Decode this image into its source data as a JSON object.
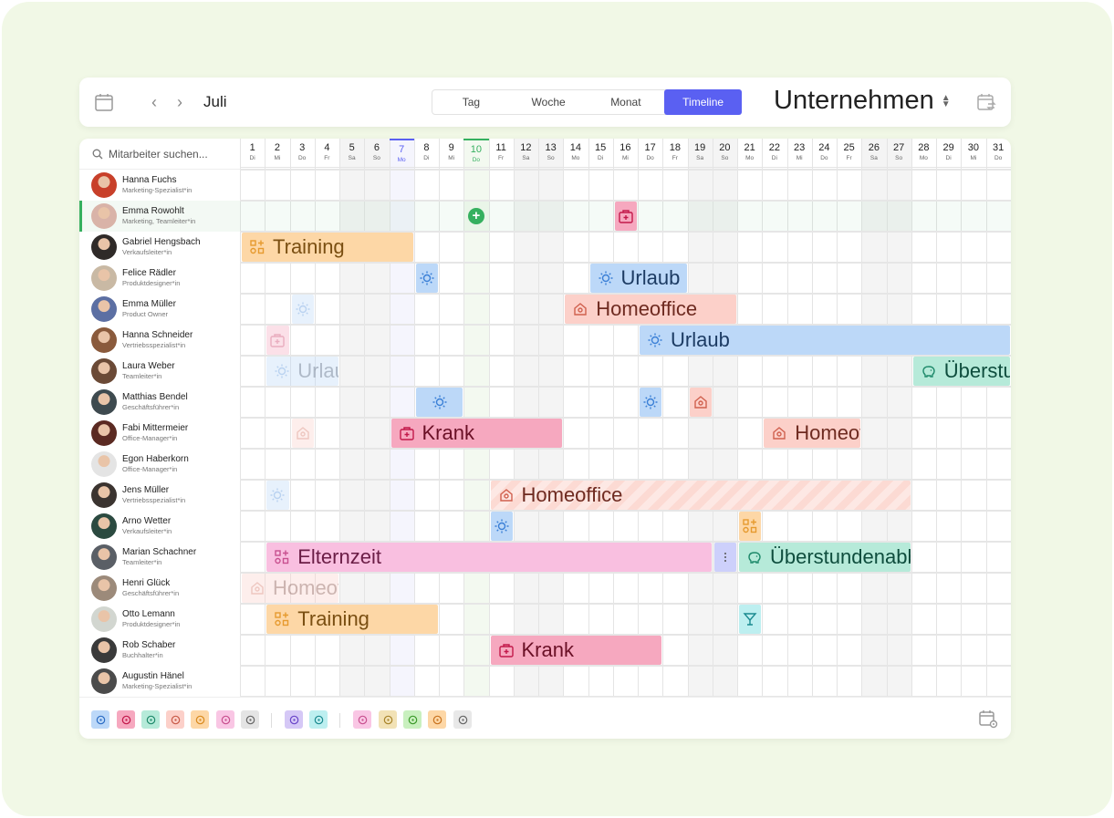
{
  "header": {
    "month": "Juli",
    "tabs": [
      "Tag",
      "Woche",
      "Monat",
      "Timeline"
    ],
    "active_tab": "Timeline",
    "company": "Unternehmen"
  },
  "search": {
    "placeholder": "Mitarbeiter suchen..."
  },
  "days": [
    {
      "d": "1",
      "w": "Di"
    },
    {
      "d": "2",
      "w": "Mi"
    },
    {
      "d": "3",
      "w": "Do"
    },
    {
      "d": "4",
      "w": "Fr"
    },
    {
      "d": "5",
      "w": "Sa"
    },
    {
      "d": "6",
      "w": "So"
    },
    {
      "d": "7",
      "w": "Mo"
    },
    {
      "d": "8",
      "w": "Di"
    },
    {
      "d": "9",
      "w": "Mi"
    },
    {
      "d": "10",
      "w": "Do"
    },
    {
      "d": "11",
      "w": "Fr"
    },
    {
      "d": "12",
      "w": "Sa"
    },
    {
      "d": "13",
      "w": "So"
    },
    {
      "d": "14",
      "w": "Mo"
    },
    {
      "d": "15",
      "w": "Di"
    },
    {
      "d": "16",
      "w": "Mi"
    },
    {
      "d": "17",
      "w": "Do"
    },
    {
      "d": "18",
      "w": "Fr"
    },
    {
      "d": "19",
      "w": "Sa"
    },
    {
      "d": "20",
      "w": "So"
    },
    {
      "d": "21",
      "w": "Mo"
    },
    {
      "d": "22",
      "w": "Di"
    },
    {
      "d": "23",
      "w": "Mi"
    },
    {
      "d": "24",
      "w": "Do"
    },
    {
      "d": "25",
      "w": "Fr"
    },
    {
      "d": "26",
      "w": "Sa"
    },
    {
      "d": "27",
      "w": "So"
    },
    {
      "d": "28",
      "w": "Mo"
    },
    {
      "d": "29",
      "w": "Di"
    },
    {
      "d": "30",
      "w": "Mi"
    },
    {
      "d": "31",
      "w": "Do"
    }
  ],
  "today_day": 7,
  "highlight_day": 10,
  "weekend_days": [
    5,
    6,
    12,
    13,
    19,
    20,
    26,
    27
  ],
  "selected_employee": 1,
  "employees": [
    {
      "name": "Hanna Fuchs",
      "role": "Marketing-Spezialist*in",
      "color": "#c8402a"
    },
    {
      "name": "Emma Rowohlt",
      "role": "Marketing, Teamleiter*in",
      "color": "#d9b3a8"
    },
    {
      "name": "Gabriel Hengsbach",
      "role": "Verkaufsleiter*in",
      "color": "#2f2a28"
    },
    {
      "name": "Felice Rädler",
      "role": "Produktdesigner*in",
      "color": "#c9b9a4"
    },
    {
      "name": "Emma Müller",
      "role": "Product Owner",
      "color": "#5c6fa3"
    },
    {
      "name": "Hanna Schneider",
      "role": "Vertriebsspezialist*in",
      "color": "#8a5a3c"
    },
    {
      "name": "Laura Weber",
      "role": "Teamleiter*in",
      "color": "#6b4a36"
    },
    {
      "name": "Matthias Bendel",
      "role": "Geschäftsführer*in",
      "color": "#3e4a4f"
    },
    {
      "name": "Fabi Mittermeier",
      "role": "Office-Manager*in",
      "color": "#5b2a22"
    },
    {
      "name": "Egon Haberkorn",
      "role": "Office-Manager*in",
      "color": "#e4e4e4"
    },
    {
      "name": "Jens Müller",
      "role": "Vertriebsspezialist*in",
      "color": "#3b3430"
    },
    {
      "name": "Arno Wetter",
      "role": "Verkaufsleiter*in",
      "color": "#2b4a40"
    },
    {
      "name": "Marian Schachner",
      "role": "Teamleiter*in",
      "color": "#5a5f66"
    },
    {
      "name": "Henri Glück",
      "role": "Geschäftsführer*in",
      "color": "#9c8a7a"
    },
    {
      "name": "Otto Lemann",
      "role": "Produktdesigner*in",
      "color": "#d2d6d0"
    },
    {
      "name": "Rob Schaber",
      "role": "Buchhalter*in",
      "color": "#3a3a3a"
    },
    {
      "name": "Augustin Hänel",
      "role": "Marketing-Spezialist*in",
      "color": "#4b4b4b"
    }
  ],
  "add_button": {
    "row": 1,
    "day": 10,
    "label": "+"
  },
  "events": [
    {
      "row": 1,
      "start": 16,
      "end": 16,
      "type": "krank",
      "icon": "medical-case-icon",
      "label": ""
    },
    {
      "row": 2,
      "start": 1,
      "end": 7,
      "type": "training",
      "icon": "training-icon",
      "label": "Training"
    },
    {
      "row": 3,
      "start": 8,
      "end": 8,
      "type": "urlaub",
      "icon": "sun-icon",
      "label": ""
    },
    {
      "row": 3,
      "start": 15,
      "end": 18,
      "type": "urlaub",
      "icon": "sun-icon",
      "label": "Urlaub"
    },
    {
      "row": 4,
      "start": 3,
      "end": 3,
      "type": "urlaub",
      "icon": "sun-icon",
      "label": "",
      "faded": true
    },
    {
      "row": 4,
      "start": 14,
      "end": 20,
      "type": "home",
      "icon": "home-icon",
      "label": "Homeoffice"
    },
    {
      "row": 5,
      "start": 2,
      "end": 2,
      "type": "krank",
      "icon": "medical-case-icon",
      "label": "",
      "faded": true
    },
    {
      "row": 5,
      "start": 17,
      "end": 31,
      "type": "urlaub",
      "icon": "sun-icon",
      "label": "Urlaub"
    },
    {
      "row": 6,
      "start": 2,
      "end": 4,
      "type": "urlaub",
      "icon": "sun-icon",
      "label": "Urlaub",
      "faded": true
    },
    {
      "row": 6,
      "start": 28,
      "end": 31,
      "type": "ueber",
      "icon": "piggy-bank-icon",
      "label": "Überstundenabbau"
    },
    {
      "row": 7,
      "start": 8,
      "end": 9,
      "type": "urlaub",
      "icon": "sun-icon",
      "label": ""
    },
    {
      "row": 7,
      "start": 17,
      "end": 17,
      "type": "urlaub",
      "icon": "sun-icon",
      "label": ""
    },
    {
      "row": 7,
      "start": 19,
      "end": 19,
      "type": "home",
      "icon": "home-icon",
      "label": ""
    },
    {
      "row": 8,
      "start": 3,
      "end": 3,
      "type": "home",
      "icon": "home-icon",
      "label": "",
      "faded": true
    },
    {
      "row": 8,
      "start": 7,
      "end": 13,
      "type": "krank",
      "icon": "medical-case-icon",
      "label": "Krank"
    },
    {
      "row": 8,
      "start": 22,
      "end": 25,
      "type": "home",
      "icon": "home-icon",
      "label": "Homeoffice"
    },
    {
      "row": 10,
      "start": 2,
      "end": 2,
      "type": "urlaub",
      "icon": "sun-icon",
      "label": "",
      "faded": true
    },
    {
      "row": 10,
      "start": 11,
      "end": 27,
      "type": "home",
      "icon": "home-icon",
      "label": "Homeoffice",
      "striped": true
    },
    {
      "row": 11,
      "start": 11,
      "end": 11,
      "type": "urlaub",
      "icon": "sun-icon",
      "label": ""
    },
    {
      "row": 11,
      "start": 21,
      "end": 21,
      "type": "training",
      "icon": "training-icon",
      "label": ""
    },
    {
      "row": 12,
      "start": 2,
      "end": 19,
      "type": "eltern",
      "icon": "training-icon",
      "label": "Elternzeit"
    },
    {
      "row": 12,
      "start": 20,
      "end": 20,
      "type": "more",
      "icon": "more-icon",
      "label": "⋮"
    },
    {
      "row": 12,
      "start": 21,
      "end": 27,
      "type": "ueber",
      "icon": "piggy-bank-icon",
      "label": "Überstundenabbau"
    },
    {
      "row": 13,
      "start": 1,
      "end": 4,
      "type": "home",
      "icon": "home-icon",
      "label": "Homeoffice",
      "faded": true
    },
    {
      "row": 14,
      "start": 2,
      "end": 8,
      "type": "training",
      "icon": "training-icon",
      "label": "Training"
    },
    {
      "row": 14,
      "start": 21,
      "end": 21,
      "type": "cocktail",
      "icon": "cocktail-icon",
      "label": ""
    },
    {
      "row": 15,
      "start": 11,
      "end": 17,
      "type": "krank",
      "icon": "medical-case-icon",
      "label": "Krank"
    }
  ],
  "legend": [
    {
      "name": "palm-tree-icon",
      "bg": "#bcd8f8",
      "fg": "#2b6cc4"
    },
    {
      "name": "medical-cross-icon",
      "bg": "#f6a8bf",
      "fg": "#c2184a"
    },
    {
      "name": "layers-icon",
      "bg": "#b6ead9",
      "fg": "#1f8a6b"
    },
    {
      "name": "home-icon",
      "bg": "#fcd0c9",
      "fg": "#c85a48"
    },
    {
      "name": "clock-icon",
      "bg": "#fdd7a6",
      "fg": "#d98a1e"
    },
    {
      "name": "clock-refresh-icon",
      "bg": "#f9c6e4",
      "fg": "#c8508f"
    },
    {
      "name": "calendar-clock-icon",
      "bg": "#e4e4e4",
      "fg": "#666666"
    },
    {
      "name": "star-icon",
      "bg": "#d5c8f6",
      "fg": "#6a45c8"
    },
    {
      "name": "cocktail-icon",
      "bg": "#bdeff0",
      "fg": "#1a8a90"
    },
    {
      "name": "cake-icon",
      "bg": "#f9c6e4",
      "fg": "#c8508f"
    },
    {
      "name": "medal-icon",
      "bg": "#f2e2b6",
      "fg": "#a8842a"
    },
    {
      "name": "bug-icon",
      "bg": "#c9f0bf",
      "fg": "#3c9a2a"
    },
    {
      "name": "clipboard-icon",
      "bg": "#fdd7a6",
      "fg": "#c8721e"
    },
    {
      "name": "exit-icon",
      "bg": "#e8e8e8",
      "fg": "#666666"
    }
  ]
}
